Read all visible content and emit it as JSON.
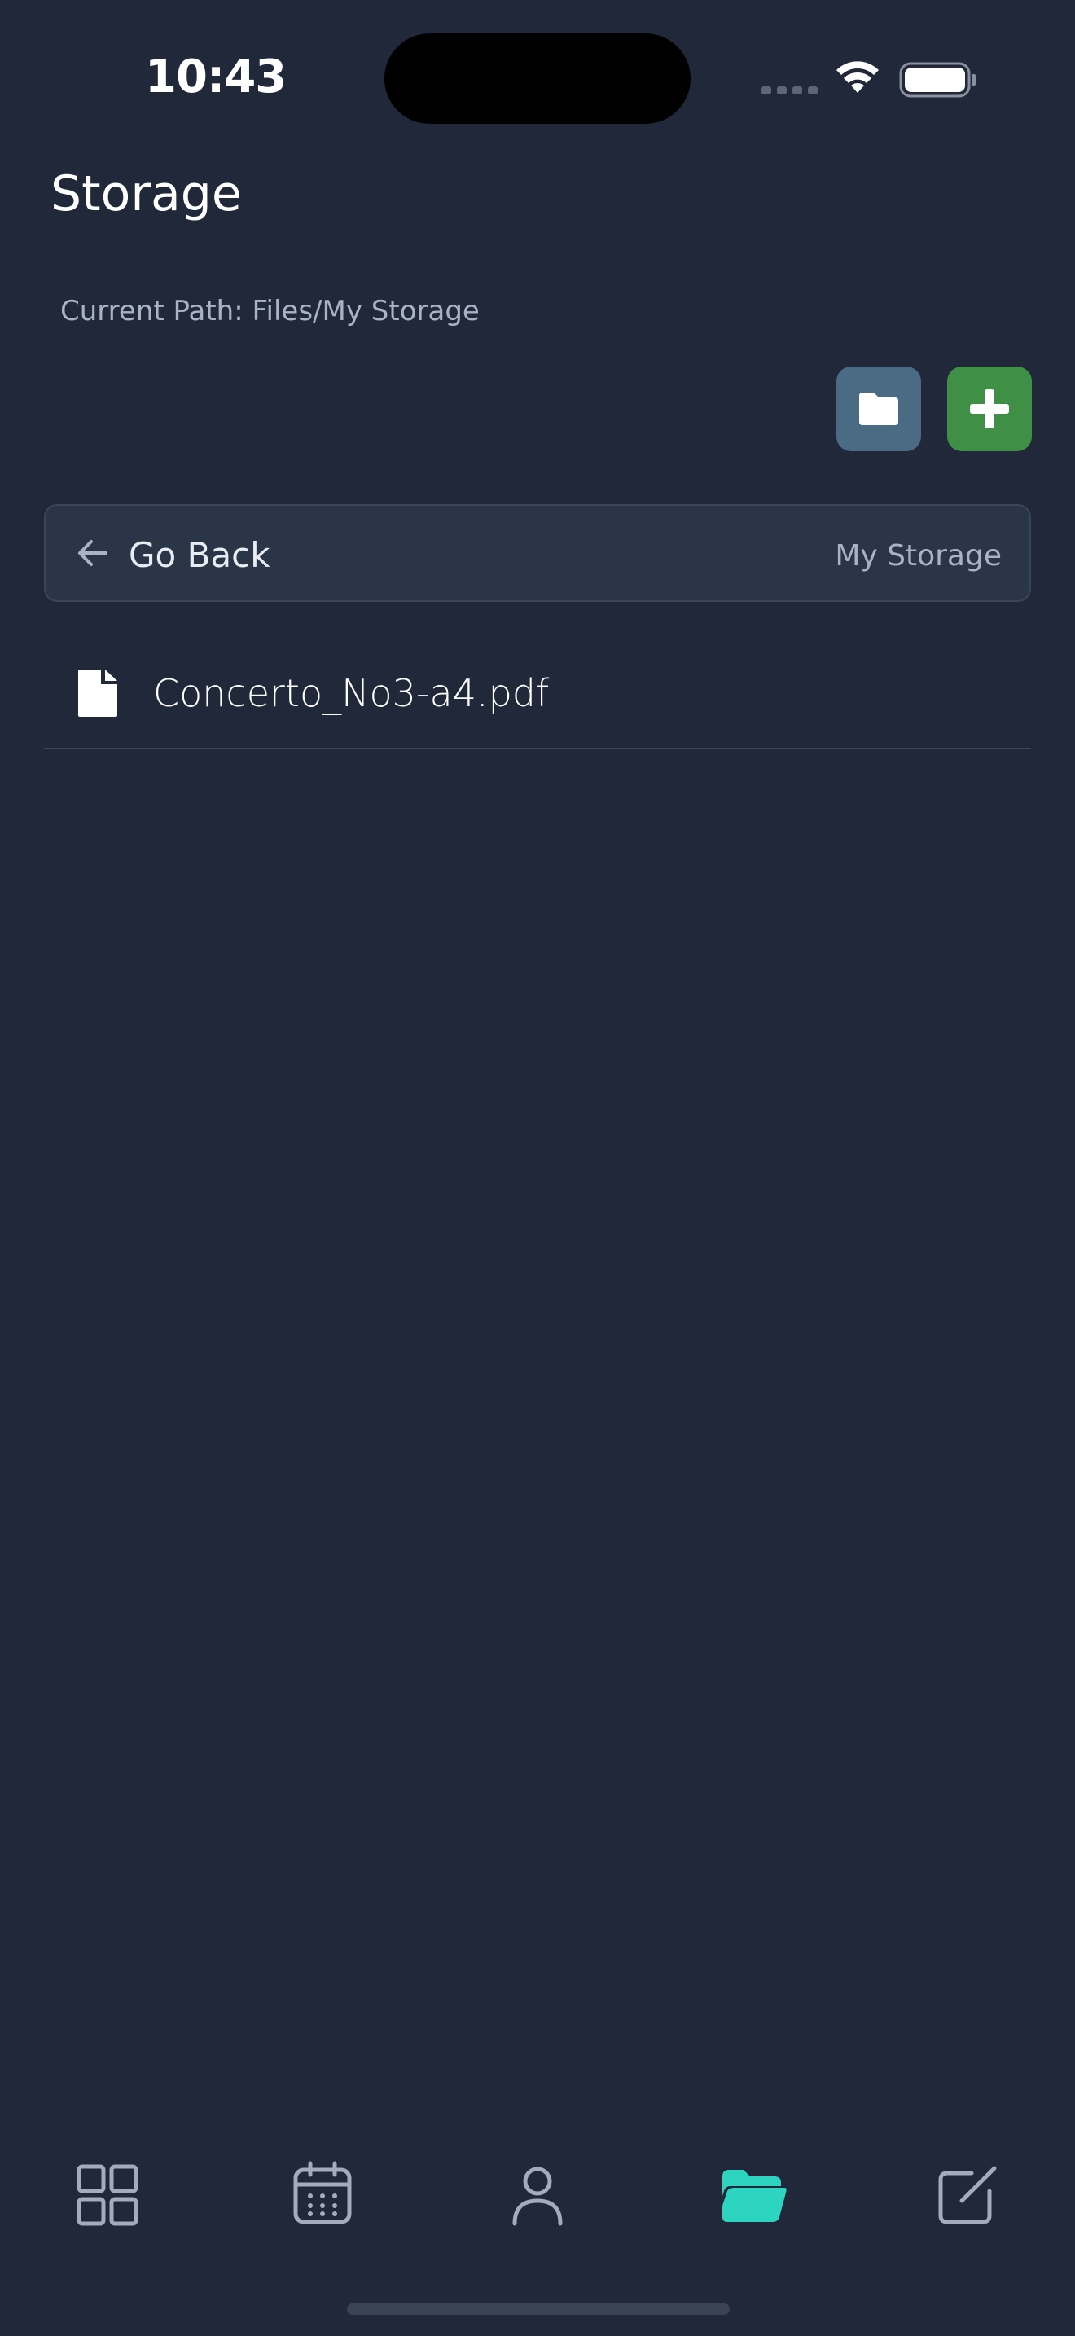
{
  "status_bar": {
    "time": "10:43"
  },
  "header": {
    "title": "Storage",
    "current_path": "Current Path: Files/My Storage"
  },
  "actions": {
    "new_folder_icon": "folder-icon",
    "add_icon": "plus-icon"
  },
  "navigation": {
    "go_back_label": "Go Back",
    "current_folder": "My Storage"
  },
  "files": [
    {
      "name": "Concerto_No3-a4.pdf",
      "icon": "file-icon"
    }
  ],
  "tab_bar": {
    "items": [
      {
        "icon": "dashboard-grid-icon",
        "active": false
      },
      {
        "icon": "calendar-icon",
        "active": false
      },
      {
        "icon": "profile-icon",
        "active": false
      },
      {
        "icon": "folder-open-icon",
        "active": true
      },
      {
        "icon": "edit-icon",
        "active": false
      }
    ],
    "active_color": "#2dd4bf",
    "inactive_color": "#a3acba"
  },
  "colors": {
    "background": "#20283a",
    "folder_button": "#4b6b85",
    "add_button": "#3f8f46"
  }
}
